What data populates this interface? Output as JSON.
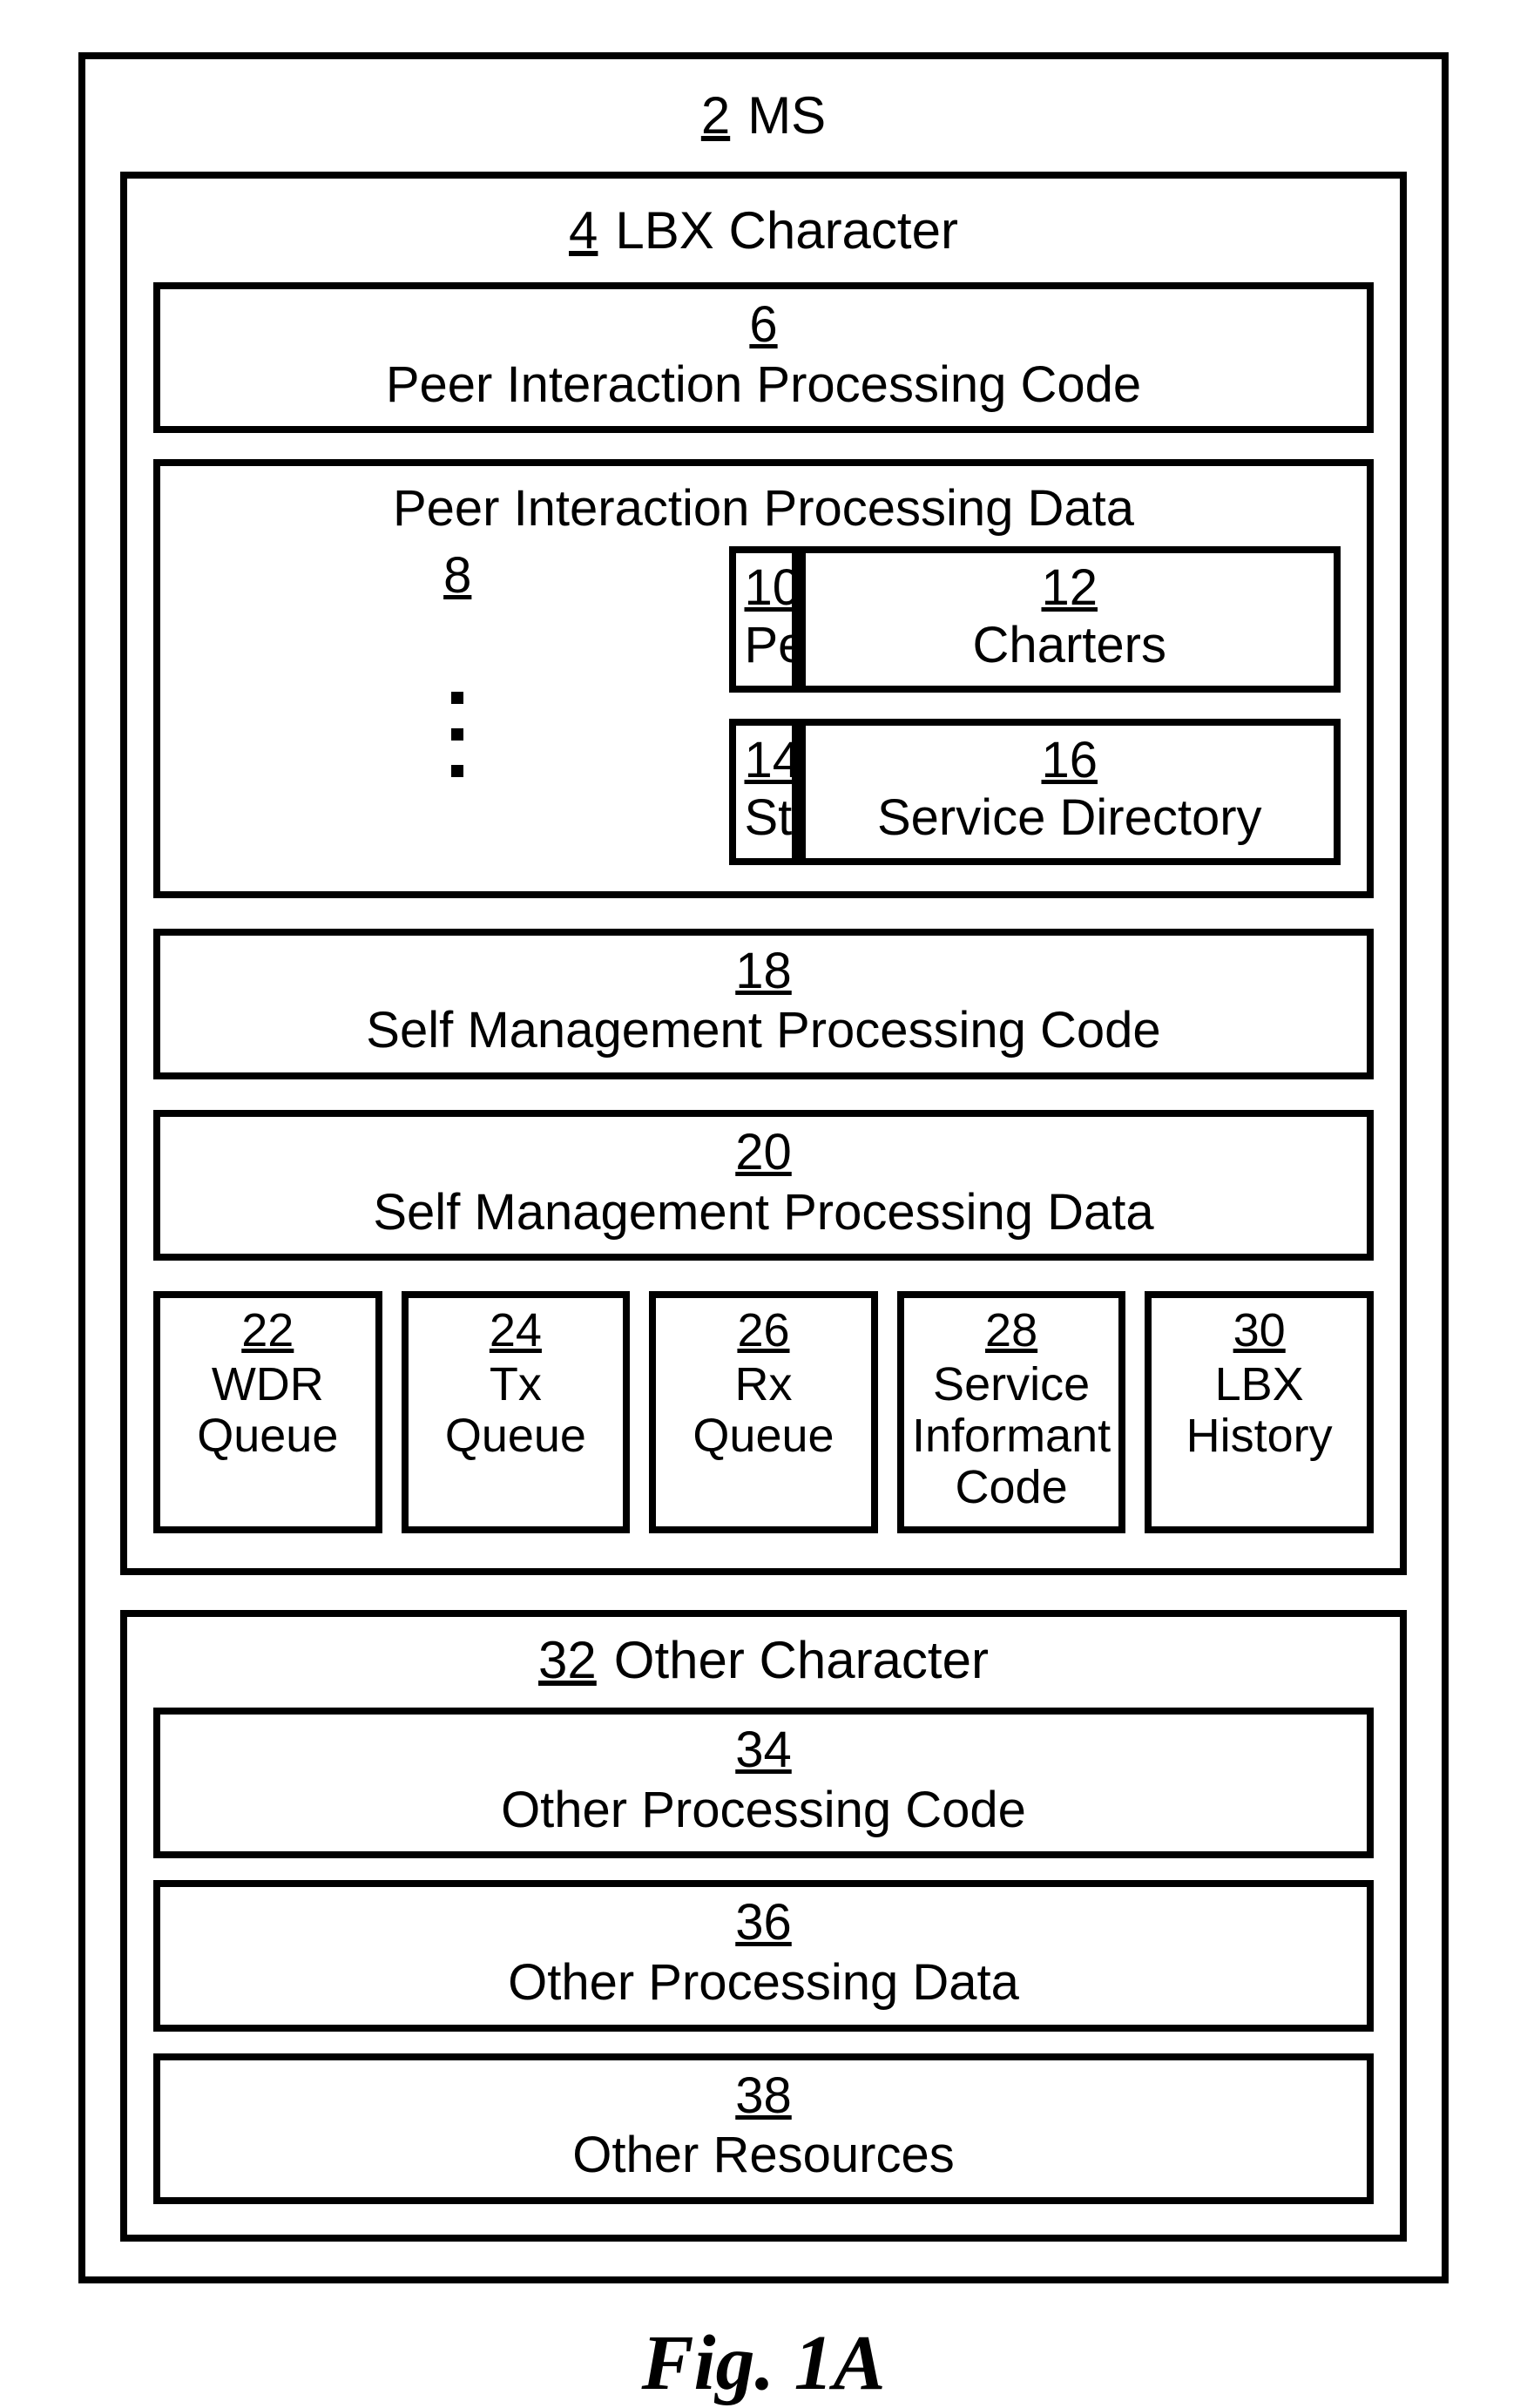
{
  "figure_label": "Fig. 1A",
  "ms": {
    "num": "2",
    "label": "MS"
  },
  "lbx": {
    "num": "4",
    "label": "LBX Character"
  },
  "peer_code": {
    "num": "6",
    "label": "Peer Interaction Processing Code"
  },
  "peer_data": {
    "title": "Peer Interaction Processing Data",
    "num": "8",
    "permissions": {
      "num": "10",
      "label": "Permissions"
    },
    "charters": {
      "num": "12",
      "label": "Charters"
    },
    "statistics": {
      "num": "14",
      "label": "Statistics"
    },
    "service_directory": {
      "num": "16",
      "label": "Service Directory"
    }
  },
  "self_code": {
    "num": "18",
    "label": "Self Management Processing Code"
  },
  "self_data": {
    "num": "20",
    "label": "Self Management Processing Data"
  },
  "queues": {
    "wdr": {
      "num": "22",
      "label": "WDR Queue"
    },
    "tx": {
      "num": "24",
      "label": "Tx Queue"
    },
    "rx": {
      "num": "26",
      "label": "Rx Queue"
    },
    "svc_inf": {
      "num": "28",
      "label": "Service Informant Code"
    },
    "lbx_hist": {
      "num": "30",
      "label": "LBX History"
    }
  },
  "other": {
    "char": {
      "num": "32",
      "label": "Other Character"
    },
    "code": {
      "num": "34",
      "label": "Other Processing Code"
    },
    "data": {
      "num": "36",
      "label": "Other Processing Data"
    },
    "resources": {
      "num": "38",
      "label": "Other Resources"
    }
  }
}
